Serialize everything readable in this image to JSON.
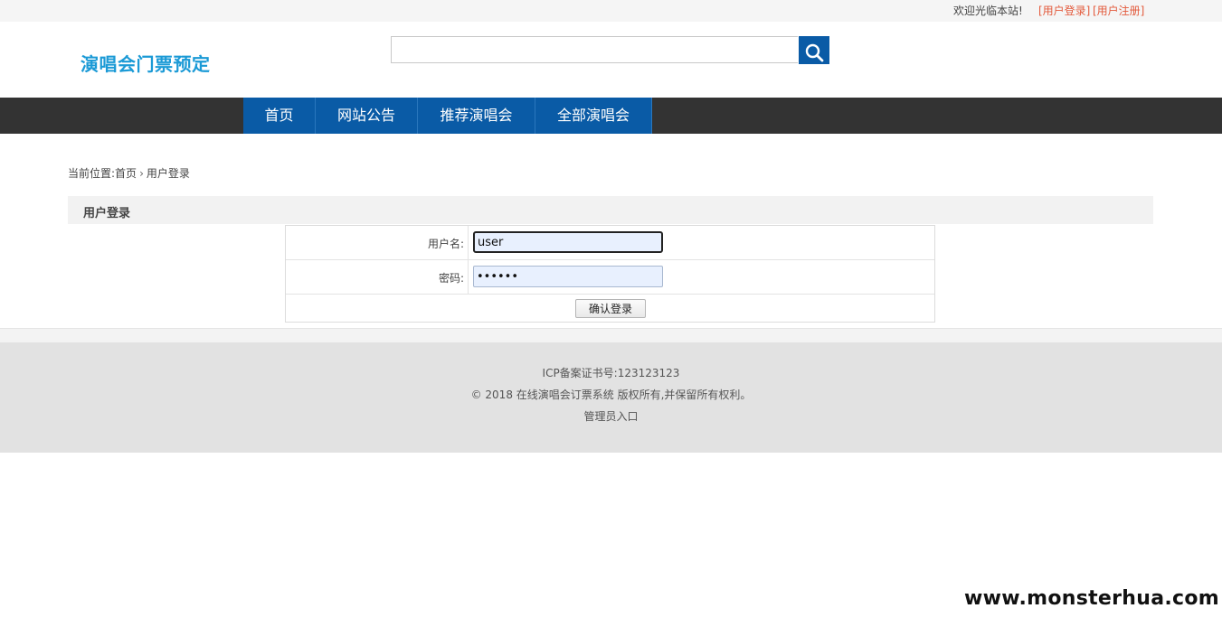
{
  "topbar": {
    "welcome": "欢迎光临本站!",
    "login_link": "[用户登录]",
    "register_link": "[用户注册]"
  },
  "header": {
    "logo": "演唱会门票预定",
    "search": {
      "value": "",
      "placeholder": "",
      "icon": "search-icon"
    }
  },
  "nav": {
    "items": [
      {
        "label": "首页"
      },
      {
        "label": "网站公告"
      },
      {
        "label": "推荐演唱会"
      },
      {
        "label": "全部演唱会"
      }
    ]
  },
  "breadcrumb": {
    "prefix": "当前位置:",
    "home": "首页",
    "separator": "›",
    "current": "用户登录"
  },
  "login_panel": {
    "title": "用户登录",
    "username_label": "用户名:",
    "username_value": "user",
    "password_label": "密码:",
    "password_value": "••••••",
    "submit_label": "确认登录"
  },
  "footer": {
    "icp": "ICP备案证书号:123123123",
    "copyright": "© 2018 在线演唱会订票系统 版权所有,并保留所有权利。",
    "admin_link": "管理员入口"
  },
  "watermark": "www.monsterhua.com",
  "colors": {
    "brand_blue": "#0a5ba6",
    "logo_blue": "#1b9ad6",
    "nav_bg": "#333333",
    "link_red": "#e35a3c"
  }
}
